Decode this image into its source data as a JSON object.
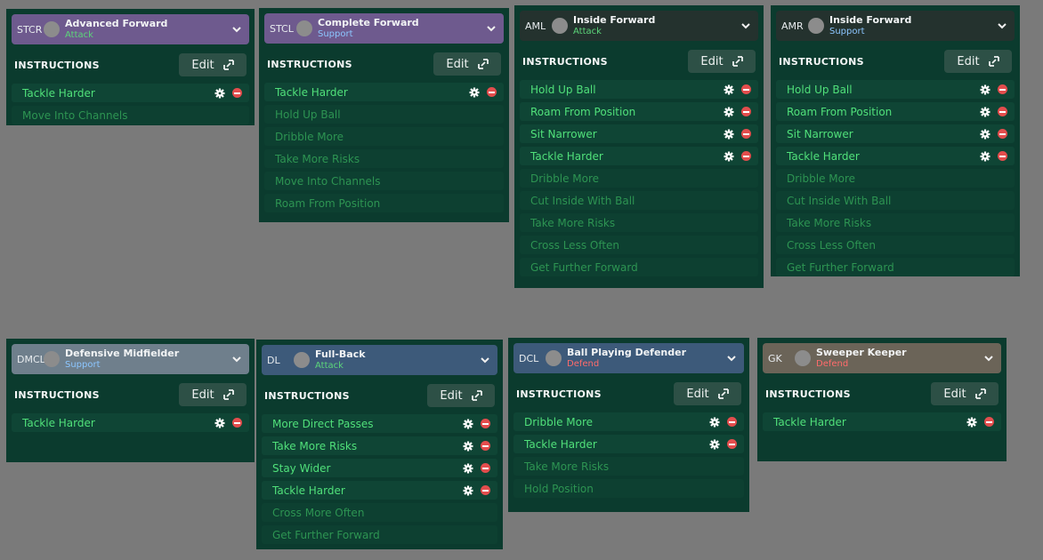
{
  "instructions_label": "INSTRUCTIONS",
  "edit_label": "Edit",
  "colors": {
    "panel": "#0b3b2e",
    "attack": "#5cd67a",
    "support": "#8cc6ff",
    "defend": "#ff6b6b",
    "active_text": "#50e07a",
    "inactive_text": "#2d9452"
  },
  "cards": [
    {
      "pos": "STCR",
      "role": "Advanced Forward",
      "duty": "Attack",
      "items": [
        {
          "label": "Tackle Harder",
          "active": true
        },
        {
          "label": "Move Into Channels",
          "active": false
        }
      ]
    },
    {
      "pos": "STCL",
      "role": "Complete Forward",
      "duty": "Support",
      "items": [
        {
          "label": "Tackle Harder",
          "active": true
        },
        {
          "label": "Hold Up Ball",
          "active": false
        },
        {
          "label": "Dribble More",
          "active": false
        },
        {
          "label": "Take More Risks",
          "active": false
        },
        {
          "label": "Move Into Channels",
          "active": false
        },
        {
          "label": "Roam From Position",
          "active": false
        }
      ]
    },
    {
      "pos": "AML",
      "role": "Inside Forward",
      "duty": "Attack",
      "items": [
        {
          "label": "Hold Up Ball",
          "active": true
        },
        {
          "label": "Roam From Position",
          "active": true
        },
        {
          "label": "Sit Narrower",
          "active": true
        },
        {
          "label": "Tackle Harder",
          "active": true
        },
        {
          "label": "Dribble More",
          "active": false
        },
        {
          "label": "Cut Inside With Ball",
          "active": false
        },
        {
          "label": "Take More Risks",
          "active": false
        },
        {
          "label": "Cross Less Often",
          "active": false
        },
        {
          "label": "Get Further Forward",
          "active": false
        }
      ]
    },
    {
      "pos": "AMR",
      "role": "Inside Forward",
      "duty": "Support",
      "items": [
        {
          "label": "Hold Up Ball",
          "active": true
        },
        {
          "label": "Roam From Position",
          "active": true
        },
        {
          "label": "Sit Narrower",
          "active": true
        },
        {
          "label": "Tackle Harder",
          "active": true
        },
        {
          "label": "Dribble More",
          "active": false
        },
        {
          "label": "Cut Inside With Ball",
          "active": false
        },
        {
          "label": "Take More Risks",
          "active": false
        },
        {
          "label": "Cross Less Often",
          "active": false
        },
        {
          "label": "Get Further Forward",
          "active": false
        }
      ]
    },
    {
      "pos": "DMCL",
      "role": "Defensive Midfielder",
      "duty": "Support",
      "items": [
        {
          "label": "Tackle Harder",
          "active": true
        }
      ]
    },
    {
      "pos": "DL",
      "role": "Full-Back",
      "duty": "Attack",
      "items": [
        {
          "label": "More Direct Passes",
          "active": true
        },
        {
          "label": "Take More Risks",
          "active": true
        },
        {
          "label": "Stay Wider",
          "active": true
        },
        {
          "label": "Tackle Harder",
          "active": true
        },
        {
          "label": "Cross More Often",
          "active": false
        },
        {
          "label": "Get Further Forward",
          "active": false
        }
      ]
    },
    {
      "pos": "DCL",
      "role": "Ball Playing Defender",
      "duty": "Defend",
      "items": [
        {
          "label": "Dribble More",
          "active": true
        },
        {
          "label": "Tackle Harder",
          "active": true
        },
        {
          "label": "Take More Risks",
          "active": false
        },
        {
          "label": "Hold Position",
          "active": false
        }
      ]
    },
    {
      "pos": "GK",
      "role": "Sweeper Keeper",
      "duty": "Defend",
      "items": [
        {
          "label": "Tackle Harder",
          "active": true
        }
      ]
    }
  ]
}
